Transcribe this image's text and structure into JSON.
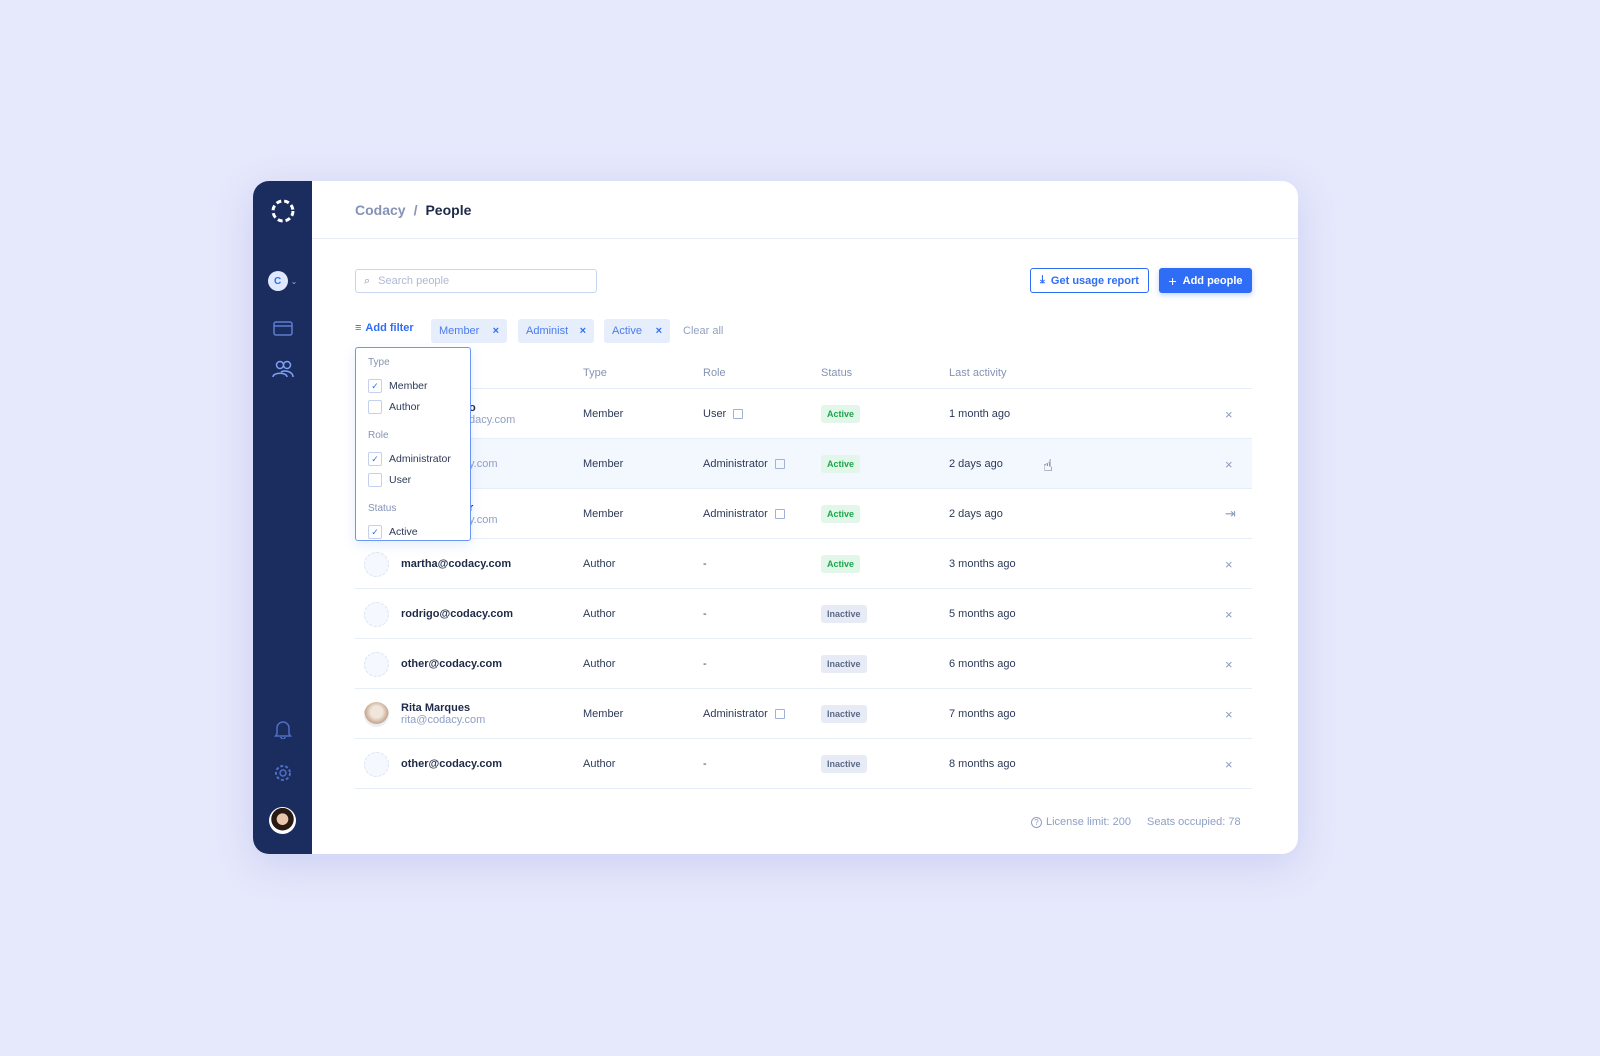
{
  "breadcrumb": {
    "org": "Codacy",
    "separator": "/",
    "page": "People"
  },
  "sidebar": {
    "org_initial": "C",
    "items": [
      "folder-icon",
      "people-icon",
      "bell-icon",
      "gear-icon"
    ]
  },
  "search": {
    "placeholder": "Search people",
    "value": ""
  },
  "toolbar": {
    "report_label": "Get usage report",
    "add_label": "Add people"
  },
  "filters": {
    "add_label": "Add filter",
    "chips": [
      "Member",
      "Administ",
      "Active"
    ],
    "clear_label": "Clear all"
  },
  "dropdown": {
    "groups": [
      {
        "label": "Type",
        "options": [
          {
            "label": "Member",
            "checked": true
          },
          {
            "label": "Author",
            "checked": false
          }
        ]
      },
      {
        "label": "Role",
        "options": [
          {
            "label": "Administrator",
            "checked": true
          },
          {
            "label": "User",
            "checked": false
          }
        ]
      },
      {
        "label": "Status",
        "options": [
          {
            "label": "Active",
            "checked": true
          }
        ]
      }
    ]
  },
  "table": {
    "headers": [
      "Type",
      "Role",
      "Status",
      "Last activity"
    ],
    "rows": [
      {
        "name": "o",
        "email": "dacy.com",
        "type": "Member",
        "role": "User",
        "editable": true,
        "status": "Active",
        "last": "1 month ago",
        "action": "remove",
        "partial": true
      },
      {
        "name": "",
        "email": "y.com",
        "type": "Member",
        "role": "Administrator",
        "editable": true,
        "status": "Active",
        "last": "2 days ago",
        "action": "remove",
        "partial": true
      },
      {
        "name": "r",
        "email": "y.com",
        "type": "Member",
        "role": "Administrator",
        "editable": true,
        "status": "Active",
        "last": "2 days ago",
        "action": "leave",
        "partial": true
      },
      {
        "name": "martha@codacy.com",
        "email": "",
        "type": "Author",
        "role": "-",
        "editable": false,
        "status": "Active",
        "last": "3 months ago",
        "action": "remove"
      },
      {
        "name": "rodrigo@codacy.com",
        "email": "",
        "type": "Author",
        "role": "-",
        "editable": false,
        "status": "Inactive",
        "last": "5 months ago",
        "action": "remove"
      },
      {
        "name": "other@codacy.com",
        "email": "",
        "type": "Author",
        "role": "-",
        "editable": false,
        "status": "Inactive",
        "last": "6 months ago",
        "action": "remove"
      },
      {
        "name": "Rita Marques",
        "email": "rita@codacy.com",
        "type": "Member",
        "role": "Administrator",
        "editable": true,
        "status": "Inactive",
        "last": "7 months ago",
        "action": "remove",
        "photo": true
      },
      {
        "name": "other@codacy.com",
        "email": "",
        "type": "Author",
        "role": "-",
        "editable": false,
        "status": "Inactive",
        "last": "8 months ago",
        "action": "remove"
      }
    ]
  },
  "footer": {
    "license": "License limit: 200",
    "seats": "Seats occupied: 78"
  },
  "colors": {
    "sidebar": "#1b2c5e",
    "accent": "#2f6df6",
    "active": "#1fa54d",
    "inactive": "#5b6b88"
  }
}
